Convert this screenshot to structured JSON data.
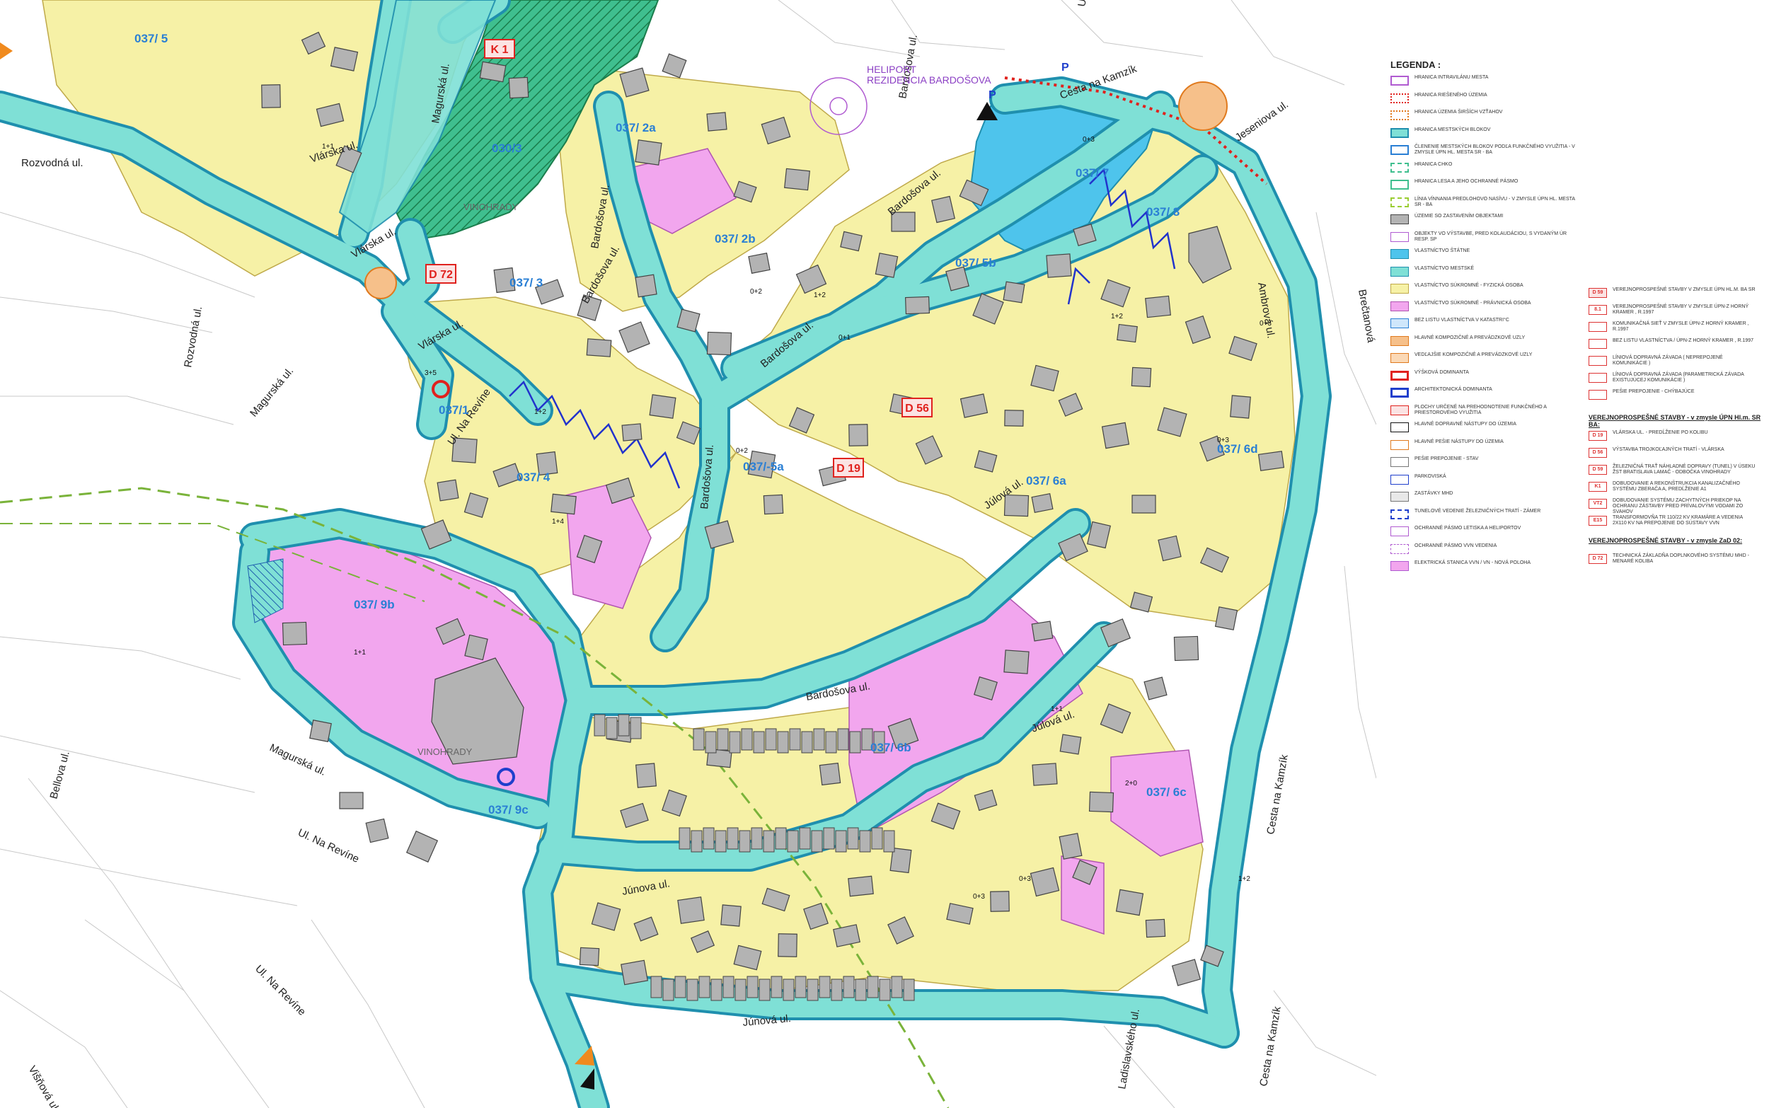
{
  "colors": {
    "private_physical": "#f6f1a6",
    "private_legal": "#f2a6ee",
    "city": "#7fe0d6",
    "state": "#4ec4ec",
    "forest": "#3fbf8f",
    "road_outline": "#1f8fae",
    "red_code": "#e0221e",
    "blue_label": "#2a7fd4"
  },
  "map": {
    "heliport_label": [
      "HELIPORT",
      "REZIDENCIA BARDOŠOVA"
    ],
    "vinohrady_labels": [
      "VINOHRADY",
      "VINOHRADY"
    ],
    "streets": [
      "Rozvodná ul.",
      "Vlárska ul.",
      "Magurská ul.",
      "Rozvodná ul.",
      "Magurská ul.",
      "Vlárska ul.",
      "Vlárska ul.",
      "Bardošova ul.",
      "Bardošova ul.",
      "Bardošova ul.",
      "Bardošova ul.",
      "Bardošova ul.",
      "Bardošova ul.",
      "Bardošova ul.",
      "Júlová ul.",
      "Júlová ul.",
      "Júnova ul.",
      "Júnová ul.",
      "Ambrová ul.",
      "Cesta na Kamzík",
      "Cesta na Kamzík",
      "Cesta na Kamzík",
      "Jeseniova ul.",
      "Bellova ul.",
      "Magurská ul.",
      "Ul. Na Revíne",
      "Ul. Na Revíne",
      "Ul. Na Revíne",
      "Višňová ul.",
      "Ladislavského ul.",
      "Ul. Ladislava Dérera",
      "Brečtanová",
      "Jesen"
    ],
    "blocks": [
      "037/ 5",
      "037/ 2a",
      "037/ 2b",
      "037/ 3",
      "037/ 5b",
      "037/ 7",
      "037/ 8",
      "037/1",
      "037/ 4",
      "037/-5a",
      "037/ 6a",
      "037/ 6d",
      "037/ 9b",
      "037/ 9c",
      "037/ 6b",
      "037/ 6c",
      "030/3"
    ],
    "codes": [
      "K 1",
      "D 72",
      "D 56",
      "D 19"
    ],
    "building_labels": [
      "0+3",
      "1+1",
      "1+2",
      "0+2",
      "3+5",
      "2+0",
      "0+1",
      "1+4"
    ]
  },
  "legend": {
    "title": "LEGENDA :",
    "items": [
      "HRANICA INTRAVILÁNU MESTA",
      "HRANICA RIEŠENÉHO ÚZEMIA",
      "HRANICA ÚZEMIA ŠIRŠÍCH VZŤAHOV",
      "HRANICA MESTSKÝCH BLOKOV",
      "ČLENENIE MESTSKÝCH BLOKOV PODĽA FUNKČNÉHO VYUŽITIA - v zmysle ÚPN Hl. mesta SR - BA",
      "HRANICA CHKO",
      "HRANICA LESA A JEHO OCHRANNÉ PÁSMO",
      "LÍNIA VÍNNANIA PREDLOHOVO NASÍVU - v zmysle ÚPN Hl. mesta SR - BA",
      "ÚZEMIE SO ZASTAVENÍM OBJEKTAMI",
      "OBJEKTY VO VÝSTAVBE, PRED KOLAUDÁCIOU, S VYDANÝM ÚR resp. SP",
      "VLASTNÍCTVO ŠTÁTNE",
      "VLASTNÍCTVO MESTSKÉ",
      "VLASTNÍCTVO SÚKROMNÉ - FYZICKÁ OSOBA",
      "VLASTNÍCTVO SÚKROMNÉ - PRÁVNICKÁ OSOBA",
      "BEZ LISTU VLASTNÍCTVA V KATASTRI°C",
      "HLAVNÉ KOMPOZIČNÉ A PREVÁDZKOVÉ UZLY",
      "VEDĽAJŠIE KOMPOZIČNÉ A PREVÁDZKOVÉ UZLY",
      "VÝŠKOVÁ DOMINANTA",
      "ARCHITEKTONICKÁ DOMINANTA",
      "PLOCHY URČENÉ NA PREHODNOTENIE FUNKČNÉHO A PRIESTOROVÉHO VYUŽITIA",
      "HLAVNÉ DOPRAVNÉ NÁSTUPY DO ÚZEMIA",
      "HLAVNÉ PEŠIE NÁSTUPY DO ÚZEMIA",
      "PEŠIE PREPOJENIE - STAV",
      "PARKOVISKÁ",
      "ZASTÁVKY MHD",
      "TUNELOVÉ VEDENIE ŽELEZNIČNÝCH TRATÍ - ZÁMER",
      "OCHRANNÉ PÁSMO LETISKA A HELIPORTOV",
      "OCHRANNÉ PÁSMO VVN VEDENIA",
      "ELEKTRICKÁ STANICA VVN / VN - NOVÁ POLOHA"
    ],
    "right_items": [
      {
        "code": "D 59",
        "text": "VEREJNOPROSPEŠNÉ STAVBY v zmysle ÚPN HL.M. BA SR"
      },
      {
        "code": "8.1",
        "text": "VEREJNOPROSPEŠNÉ STAVBY v zmysle ÚPN-Z HORNÝ KRAMER , r.1997"
      },
      {
        "code": "",
        "text": "KOMUNIKAČNÁ SIEŤ v zmysle ÚPN-Z HORNÝ KRAMER , r.1997"
      },
      {
        "code": "",
        "text": "BEZ LISTU VLASTNÍCTVA / ÚPN-Z HORNÝ KRAMER , r.1997"
      },
      {
        "code": "",
        "text": "LÍNIOVÁ DOPRAVNÁ ZÁVADA ( NEPREPOJENÉ KOMUNIKÁCIE )"
      },
      {
        "code": "",
        "text": "LÍNIOVÁ DOPRAVNÁ ZÁVADA (PARAMETRICKÁ ZÁVADA EXISTUJÚCEJ KOMUNIKÁCIE )"
      },
      {
        "code": "",
        "text": "PEŠIE PREPOJENIE - CHÝBAJÚCE"
      }
    ],
    "vps_heading": "VEREJNOPROSPEŠNÉ STAVBY - v zmysle ÚPN Hl.m. SR BA:",
    "vps_items": [
      {
        "code": "D 19",
        "text": "VLÁRSKA UL. - PREDĹŽENIE PO KOLIBU"
      },
      {
        "code": "D 56",
        "text": "VÝSTAVBA TROJKOĽAJNÝCH TRATÍ - VLÁRSKA"
      },
      {
        "code": "D 59",
        "text": "ŽELEZNIČNÁ TRAŤ NÁHLADNÉ DOPRAVY (TUNEL) V ÚSEKU ŽST BRATISLAVA LAMAČ - ODBOČKA VINOHRADY"
      },
      {
        "code": "K1",
        "text": "DOBUDOVANIE A REKONŠTRUKCIA KANALIZAČNÉHO SYSTÉMU ZBERAČA A, PREDĹŽENIE A1"
      },
      {
        "code": "VT2",
        "text": "DOBUDOVANIE SYSTÉMU ZACHYTNÝCH PRIEKOP NA OCHRANU ZÁSTAVBY PRED PRÍVALOVÝMI VODAMI ZO SVAHOV"
      },
      {
        "code": "E15",
        "text": "TRANSFORMOVŇA TR 110/22 kV KRAMÁRE A VEDENIA 2x110 kV NA PREPOJENIE DO SÚSTAVY VVN"
      }
    ],
    "zad_heading": "VEREJNOPROSPEŠNÉ STAVBY - v zmysle ZaD 02:",
    "zad_items": [
      {
        "code": "D 72",
        "text": "TECHNICKÁ ZÁKLADŇA DOPLNKOVÉHO SYSTÉMU MHD - MENARÉ KOLIBA"
      }
    ]
  }
}
